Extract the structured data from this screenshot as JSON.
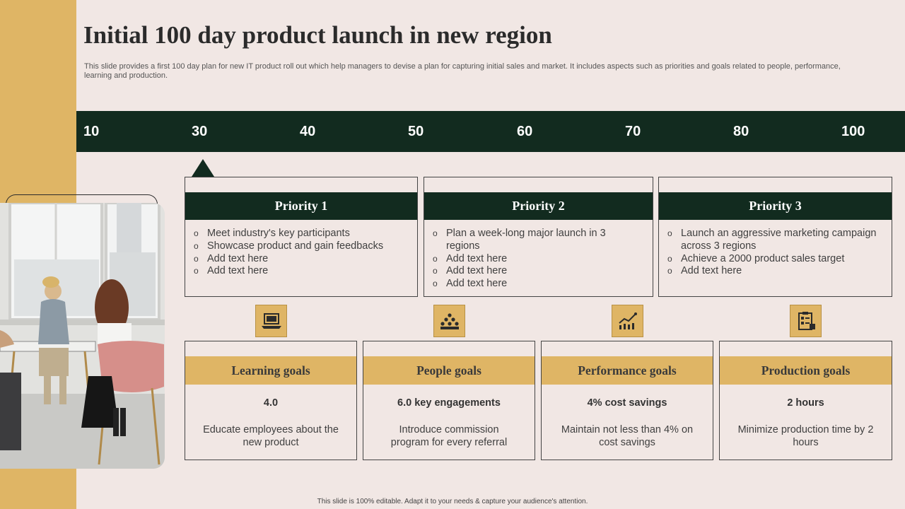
{
  "title": "Initial 100 day product launch in new region",
  "subtitle": "This slide provides a first 100 day plan for new IT product roll out which help managers to devise a plan for capturing initial sales and market. It includes aspects such as priorities and goals related to people, performance, learning and production.",
  "timeline": [
    "10",
    "30",
    "40",
    "50",
    "60",
    "70",
    "80",
    "100"
  ],
  "priorities": [
    {
      "label": "Priority 1",
      "items": [
        "Meet industry's key participants",
        "Showcase product and gain feedbacks",
        "Add text here",
        "Add text here"
      ]
    },
    {
      "label": "Priority 2",
      "items": [
        "Plan a week-long major launch in 3 regions",
        "Add text here",
        "Add text here",
        "Add text here"
      ]
    },
    {
      "label": "Priority 3",
      "items": [
        "Launch an aggressive marketing campaign across 3 regions",
        "Achieve a 2000 product sales target",
        "Add text here"
      ]
    }
  ],
  "goals": [
    {
      "label": "Learning goals",
      "icon": "laptop-icon",
      "metric": "4.0",
      "desc": "Educate employees about the new product"
    },
    {
      "label": "People goals",
      "icon": "people-group-icon",
      "metric": "6.0 key engagements",
      "desc": "Introduce commission program for every referral"
    },
    {
      "label": "Performance goals",
      "icon": "performance-chart-icon",
      "metric": "4% cost savings",
      "desc": "Maintain not less than 4% on cost savings"
    },
    {
      "label": "Production goals",
      "icon": "clipboard-icon",
      "metric": "2 hours",
      "desc": "Minimize production time by 2 hours"
    }
  ],
  "footer": "This slide is 100% editable.  Adapt it to your needs & capture your audience's attention.",
  "colors": {
    "dark_green": "#122b1f",
    "gold": "#dfb565",
    "background": "#f1e7e4"
  }
}
